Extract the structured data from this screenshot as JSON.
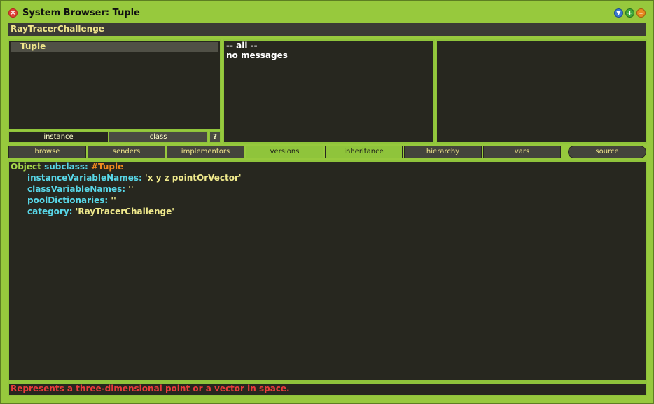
{
  "window": {
    "title": "System Browser: Tuple",
    "close_glyph": "×",
    "menu_glyph": "▼",
    "expand_glyph": "+",
    "collapse_glyph": "–"
  },
  "package": "RayTracerChallenge",
  "classes": [
    "Tuple"
  ],
  "categories": [
    "-- all --",
    "no messages"
  ],
  "class_toggle": {
    "instance": "instance",
    "class": "class",
    "help": "?"
  },
  "toolbar": {
    "browse": "browse",
    "senders": "senders",
    "implementors": "implementors",
    "versions": "versions",
    "inheritance": "inheritance",
    "hierarchy": "hierarchy",
    "vars": "vars",
    "source": "source"
  },
  "code": {
    "line1": {
      "object": "Object",
      "subclass": "subclass:",
      "name": "#Tuple"
    },
    "line2": {
      "key": "instanceVariableNames:",
      "value": "'x y z pointOrVector'"
    },
    "line3": {
      "key": "classVariableNames:",
      "value": "''"
    },
    "line4": {
      "key": "poolDictionaries:",
      "value": "''"
    },
    "line5": {
      "key": "category:",
      "value": "'RayTracerChallenge'"
    }
  },
  "comment": "Represents a three-dimensional point or a vector in space.",
  "colors": {
    "window_frame": "#97c93d",
    "pane_bg": "#27271f",
    "comment_text": "#ea3c3c"
  }
}
